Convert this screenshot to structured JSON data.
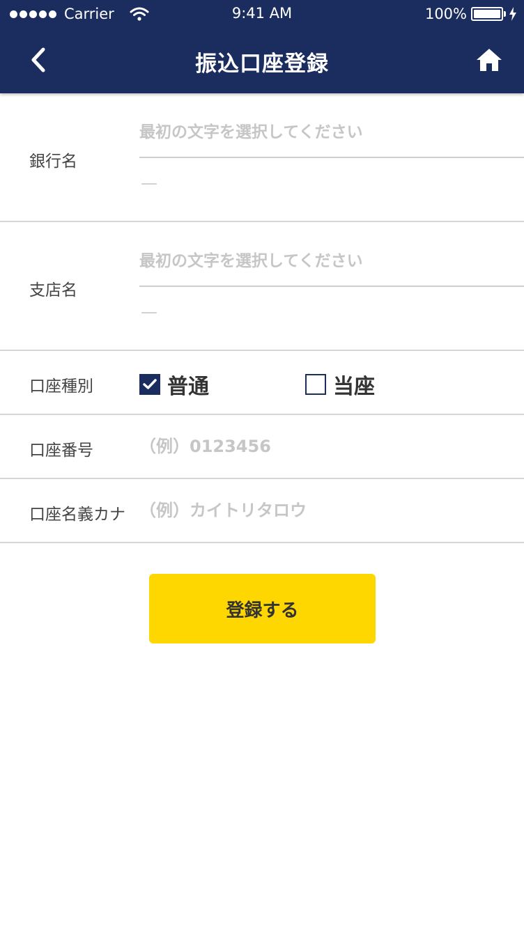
{
  "status_bar": {
    "carrier": "Carrier",
    "time": "9:41 AM",
    "battery": "100%"
  },
  "nav": {
    "title": "振込口座登録",
    "back_icon": "chevron-left-icon",
    "home_icon": "home-icon"
  },
  "form": {
    "bank": {
      "label": "銀行名",
      "placeholder": "最初の文字を選択してください",
      "value": "—"
    },
    "branch": {
      "label": "支店名",
      "placeholder": "最初の文字を選択してください",
      "value": "—"
    },
    "account_type": {
      "label": "口座種別",
      "options": [
        {
          "label": "普通",
          "checked": true
        },
        {
          "label": "当座",
          "checked": false
        }
      ]
    },
    "account_number": {
      "label": "口座番号",
      "placeholder": "（例）0123456",
      "value": ""
    },
    "account_holder": {
      "label": "口座名義カナ",
      "placeholder": "（例）カイトリタロウ",
      "value": ""
    }
  },
  "submit_label": "登録する",
  "colors": {
    "header_bg": "#1b2c5e",
    "accent_button": "#ffd700",
    "placeholder": "#c6c6c6",
    "divider": "#d6d6d6"
  }
}
